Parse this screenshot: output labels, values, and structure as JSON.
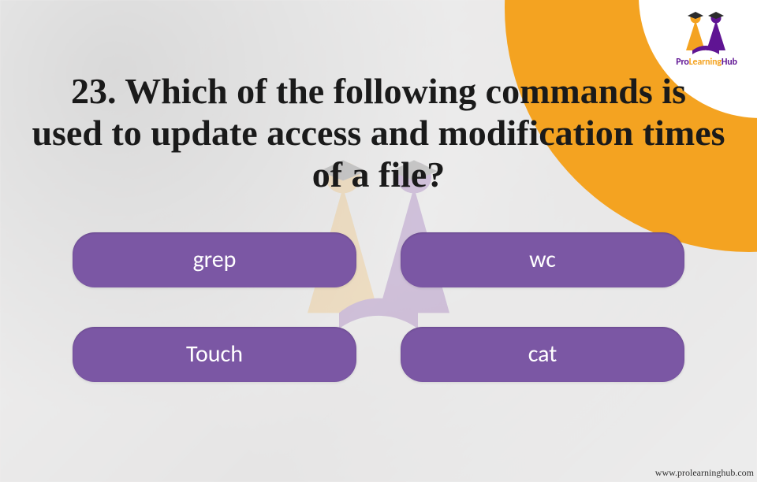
{
  "brand": {
    "name_parts": {
      "pro": "Pro",
      "learning": "Learning",
      "hub": "Hub"
    },
    "logo_colors": {
      "cap": "#5f1493",
      "accent": "#f4a321"
    }
  },
  "decor": {
    "arc_outer": "#5f1493",
    "arc_mid": "#f4a321",
    "arc_inner": "#ffffff"
  },
  "question": {
    "number": "23",
    "text": "23. Which of the following commands is used to update access and modification times of a file?"
  },
  "options": [
    {
      "id": "opt-grep",
      "label": "grep"
    },
    {
      "id": "opt-wc",
      "label": "wc"
    },
    {
      "id": "opt-touch",
      "label": "Touch"
    },
    {
      "id": "opt-cat",
      "label": "cat"
    }
  ],
  "option_color": "#7b57a4",
  "footer": {
    "url": "www.prolearninghub.com"
  }
}
